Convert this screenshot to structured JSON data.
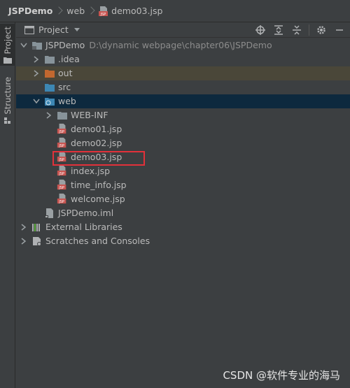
{
  "breadcrumb": {
    "project": "JSPDemo",
    "folder": "web",
    "file": "demo03.jsp"
  },
  "stripe": {
    "project_tab": "Project",
    "structure_tab": "Structure"
  },
  "panel": {
    "title": "Project"
  },
  "tree": {
    "root": {
      "name": "JSPDemo",
      "path": "D:\\dynamic webpage\\chapter06\\JSPDemo"
    },
    "idea": ".idea",
    "out": "out",
    "src": "src",
    "web": "web",
    "webinf": "WEB-INF",
    "files": [
      "demo01.jsp",
      "demo02.jsp",
      "demo03.jsp",
      "index.jsp",
      "time_info.jsp",
      "welcome.jsp"
    ],
    "iml": "JSPDemo.iml",
    "ext_libs": "External Libraries",
    "scratches": "Scratches and Consoles"
  },
  "watermark": "CSDN @软件专业的海马",
  "colors": {
    "folder": "#87939a",
    "out_folder": "#c2682f",
    "src_folder": "#3d87b4",
    "jsp_badge": "#c75450",
    "selection_out": "#4a4739",
    "selection_web": "#0d293e",
    "highlight": "#e2313a"
  }
}
